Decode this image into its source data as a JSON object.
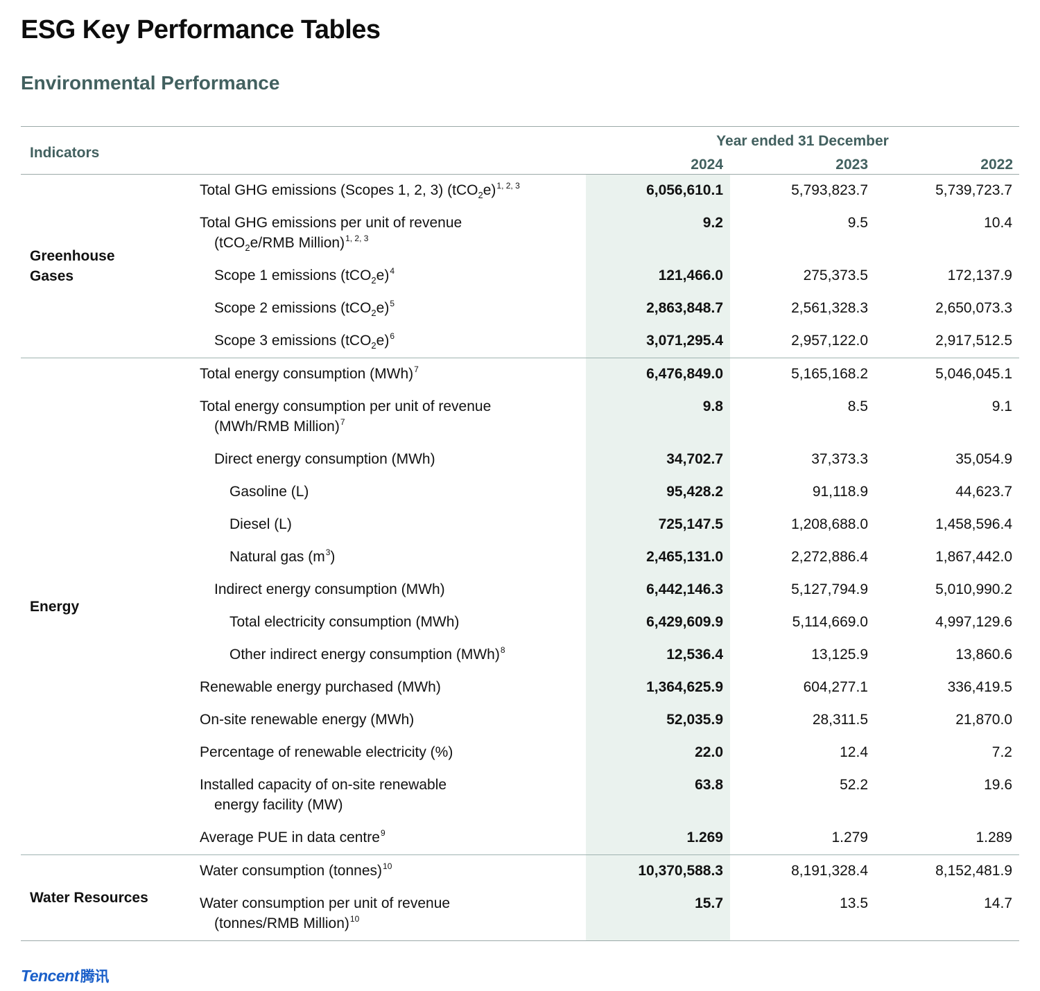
{
  "page_title": "ESG Key Performance Tables",
  "section_title": "Environmental Performance",
  "table": {
    "indicators_header": "Indicators",
    "year_header": "Year ended 31 December",
    "years": [
      "2024",
      "2023",
      "2022"
    ],
    "highlight_color": "#eaf2ee",
    "groups": [
      {
        "category": [
          "Greenhouse",
          "Gases"
        ],
        "rows": [
          {
            "level": 0,
            "segments": [
              {
                "t": "Total GHG emissions (Scopes 1, 2, 3) (tCO"
              },
              {
                "sub": "2"
              },
              {
                "t": "e)"
              },
              {
                "sup": "1, 2, 3"
              }
            ],
            "values": [
              "6,056,610.1",
              "5,793,823.7",
              "5,739,723.7"
            ]
          },
          {
            "level": 0,
            "segments": [
              {
                "t": "Total GHG emissions per unit of revenue"
              }
            ],
            "cont": [
              {
                "t": "(tCO"
              },
              {
                "sub": "2"
              },
              {
                "t": "e/RMB Million)"
              },
              {
                "sup": "1, 2, 3"
              }
            ],
            "values": [
              "9.2",
              "9.5",
              "10.4"
            ]
          },
          {
            "level": 1,
            "segments": [
              {
                "t": "Scope 1 emissions (tCO"
              },
              {
                "sub": "2"
              },
              {
                "t": "e)"
              },
              {
                "sup": "4"
              }
            ],
            "values": [
              "121,466.0",
              "275,373.5",
              "172,137.9"
            ]
          },
          {
            "level": 1,
            "segments": [
              {
                "t": "Scope 2 emissions (tCO"
              },
              {
                "sub": "2"
              },
              {
                "t": "e)"
              },
              {
                "sup": "5"
              }
            ],
            "values": [
              "2,863,848.7",
              "2,561,328.3",
              "2,650,073.3"
            ]
          },
          {
            "level": 1,
            "segments": [
              {
                "t": "Scope 3 emissions (tCO"
              },
              {
                "sub": "2"
              },
              {
                "t": "e)"
              },
              {
                "sup": "6"
              }
            ],
            "values": [
              "3,071,295.4",
              "2,957,122.0",
              "2,917,512.5"
            ]
          }
        ]
      },
      {
        "category": [
          "Energy"
        ],
        "rows": [
          {
            "level": 0,
            "segments": [
              {
                "t": "Total energy consumption (MWh)"
              },
              {
                "sup": "7"
              }
            ],
            "values": [
              "6,476,849.0",
              "5,165,168.2",
              "5,046,045.1"
            ]
          },
          {
            "level": 0,
            "segments": [
              {
                "t": "Total energy consumption per unit of revenue"
              }
            ],
            "cont": [
              {
                "t": "(MWh/RMB Million)"
              },
              {
                "sup": "7"
              }
            ],
            "values": [
              "9.8",
              "8.5",
              "9.1"
            ]
          },
          {
            "level": 1,
            "segments": [
              {
                "t": "Direct energy consumption (MWh)"
              }
            ],
            "values": [
              "34,702.7",
              "37,373.3",
              "35,054.9"
            ]
          },
          {
            "level": 2,
            "segments": [
              {
                "t": "Gasoline (L)"
              }
            ],
            "values": [
              "95,428.2",
              "91,118.9",
              "44,623.7"
            ]
          },
          {
            "level": 2,
            "segments": [
              {
                "t": "Diesel (L)"
              }
            ],
            "values": [
              "725,147.5",
              "1,208,688.0",
              "1,458,596.4"
            ]
          },
          {
            "level": 2,
            "segments": [
              {
                "t": "Natural gas (m"
              },
              {
                "sup": "3"
              },
              {
                "t": ")"
              }
            ],
            "values": [
              "2,465,131.0",
              "2,272,886.4",
              "1,867,442.0"
            ]
          },
          {
            "level": 1,
            "segments": [
              {
                "t": "Indirect energy consumption (MWh)"
              }
            ],
            "values": [
              "6,442,146.3",
              "5,127,794.9",
              "5,010,990.2"
            ]
          },
          {
            "level": 2,
            "segments": [
              {
                "t": "Total electricity consumption (MWh)"
              }
            ],
            "values": [
              "6,429,609.9",
              "5,114,669.0",
              "4,997,129.6"
            ]
          },
          {
            "level": 2,
            "segments": [
              {
                "t": "Other indirect energy consumption (MWh)"
              },
              {
                "sup": "8"
              }
            ],
            "values": [
              "12,536.4",
              "13,125.9",
              "13,860.6"
            ]
          },
          {
            "level": 0,
            "segments": [
              {
                "t": "Renewable energy purchased (MWh)"
              }
            ],
            "values": [
              "1,364,625.9",
              "604,277.1",
              "336,419.5"
            ]
          },
          {
            "level": 0,
            "segments": [
              {
                "t": "On-site renewable energy (MWh)"
              }
            ],
            "values": [
              "52,035.9",
              "28,311.5",
              "21,870.0"
            ]
          },
          {
            "level": 0,
            "segments": [
              {
                "t": "Percentage of renewable electricity (%)"
              }
            ],
            "values": [
              "22.0",
              "12.4",
              "7.2"
            ]
          },
          {
            "level": 0,
            "segments": [
              {
                "t": "Installed capacity of on-site renewable"
              }
            ],
            "cont": [
              {
                "t": "energy facility (MW)"
              }
            ],
            "values": [
              "63.8",
              "52.2",
              "19.6"
            ]
          },
          {
            "level": 0,
            "segments": [
              {
                "t": "Average PUE in data centre"
              },
              {
                "sup": "9"
              }
            ],
            "values": [
              "1.269",
              "1.279",
              "1.289"
            ]
          }
        ]
      },
      {
        "category": [
          "Water Resources"
        ],
        "rows": [
          {
            "level": 0,
            "segments": [
              {
                "t": "Water consumption (tonnes)"
              },
              {
                "sup": "10"
              }
            ],
            "values": [
              "10,370,588.3",
              "8,191,328.4",
              "8,152,481.9"
            ]
          },
          {
            "level": 0,
            "segments": [
              {
                "t": "Water consumption per unit of revenue"
              }
            ],
            "cont": [
              {
                "t": "(tonnes/RMB Million)"
              },
              {
                "sup": "10"
              }
            ],
            "values": [
              "15.7",
              "13.5",
              "14.7"
            ]
          }
        ]
      }
    ]
  },
  "logo": {
    "text": "Tencent",
    "chinese": "腾讯",
    "color": "#1a5fc9"
  }
}
